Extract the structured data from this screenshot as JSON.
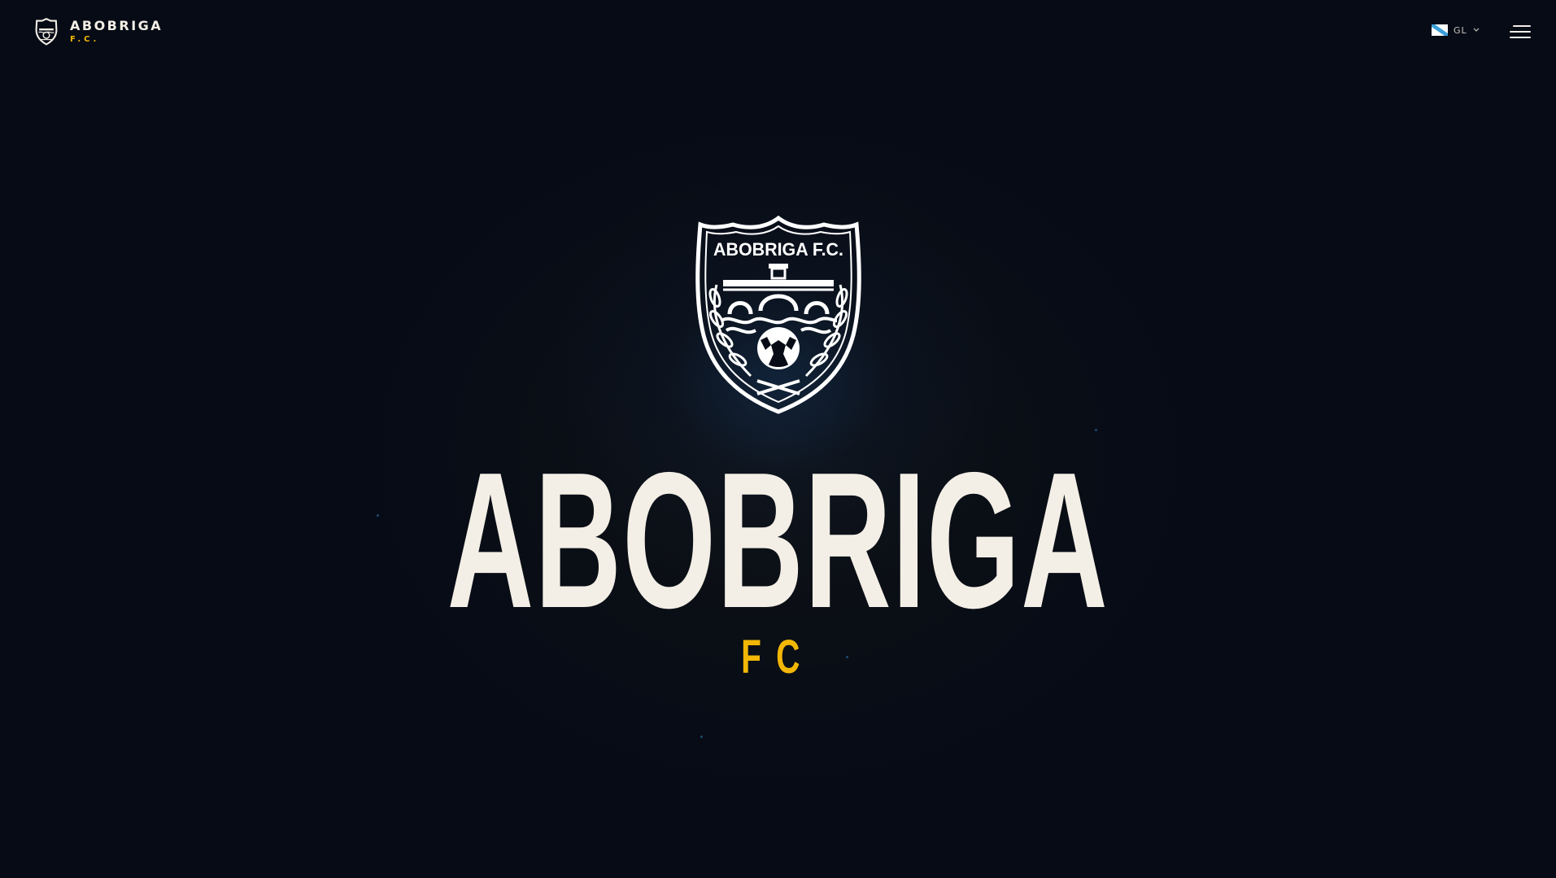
{
  "header": {
    "brand_name": "ABOBRIGA",
    "brand_sub": "F.C.",
    "language_code": "GL"
  },
  "hero": {
    "crest_text": "ABOBRIGA F.C.",
    "title": "ABOBRIGA",
    "subtitle": "FC"
  },
  "icons": {
    "brand": "club-crest-icon",
    "language_flag": "galicia-flag-icon",
    "language_dropdown": "chevron-down-icon",
    "menu": "hamburger-menu-icon"
  },
  "colors": {
    "background": "#060b16",
    "text": "#f4efe6",
    "accent": "#f2b705",
    "glow": "#163a66"
  }
}
